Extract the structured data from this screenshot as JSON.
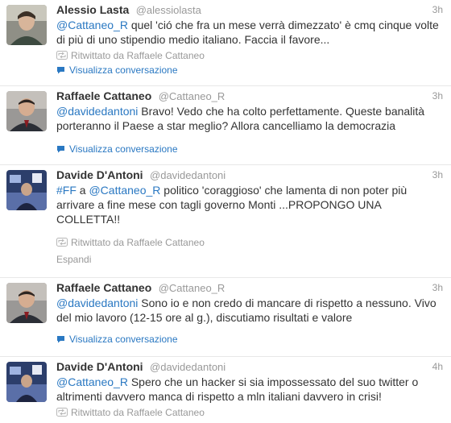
{
  "tweets": [
    {
      "fullname": "Alessio Lasta",
      "username": "@alessiolasta",
      "time": "3h",
      "mention": "@Cattaneo_R",
      "text_after": " quel 'ció che fra un mese verrà dimezzato' è cmq cinque volte di più di uno stipendio medio italiano. Faccia il favore...",
      "retweet": "Ritwittato da Raffaele Cattaneo",
      "conversation": "Visualizza conversazione"
    },
    {
      "fullname": "Raffaele Cattaneo",
      "username": "@Cattaneo_R",
      "time": "3h",
      "mention": "@davidedantoni",
      "text_after": " Bravo! Vedo che ha colto perfettamente. Queste banalità porteranno il Paese a star meglio? Allora cancelliamo la democrazia",
      "conversation": "Visualizza conversazione"
    },
    {
      "fullname": "Davide D'Antoni",
      "username": "@davidedantoni",
      "time": "3h",
      "hashtag": "#FF",
      "text_mid": " a ",
      "mention": "@Cattaneo_R",
      "text_after": " politico 'coraggioso' che lamenta di non poter più arrivare a fine mese con tagli governo Monti ...PROPONGO UNA COLLETTA!!",
      "retweet": "Ritwittato da Raffaele Cattaneo",
      "expand": "Espandi"
    },
    {
      "fullname": "Raffaele Cattaneo",
      "username": "@Cattaneo_R",
      "time": "3h",
      "mention": "@davidedantoni",
      "text_after": " Sono io e non credo di mancare di rispetto a nessuno. Vivo del mio lavoro (12-15 ore al g.), discutiamo risultati e valore",
      "conversation": "Visualizza conversazione"
    },
    {
      "fullname": "Davide D'Antoni",
      "username": "@davidedantoni",
      "time": "4h",
      "mention": "@Cattaneo_R",
      "text_after": " Spero che un hacker si sia impossessato del suo twitter o altrimenti davvero manca di rispetto a mln italiani davvero in crisi!",
      "retweet": "Ritwittato da Raffaele Cattaneo"
    }
  ],
  "colors": {
    "link": "#2a78c2",
    "muted": "#999999",
    "text": "#333333"
  },
  "icons": {
    "retweet": "retweet-icon",
    "conversation": "speech-bubble-icon"
  }
}
